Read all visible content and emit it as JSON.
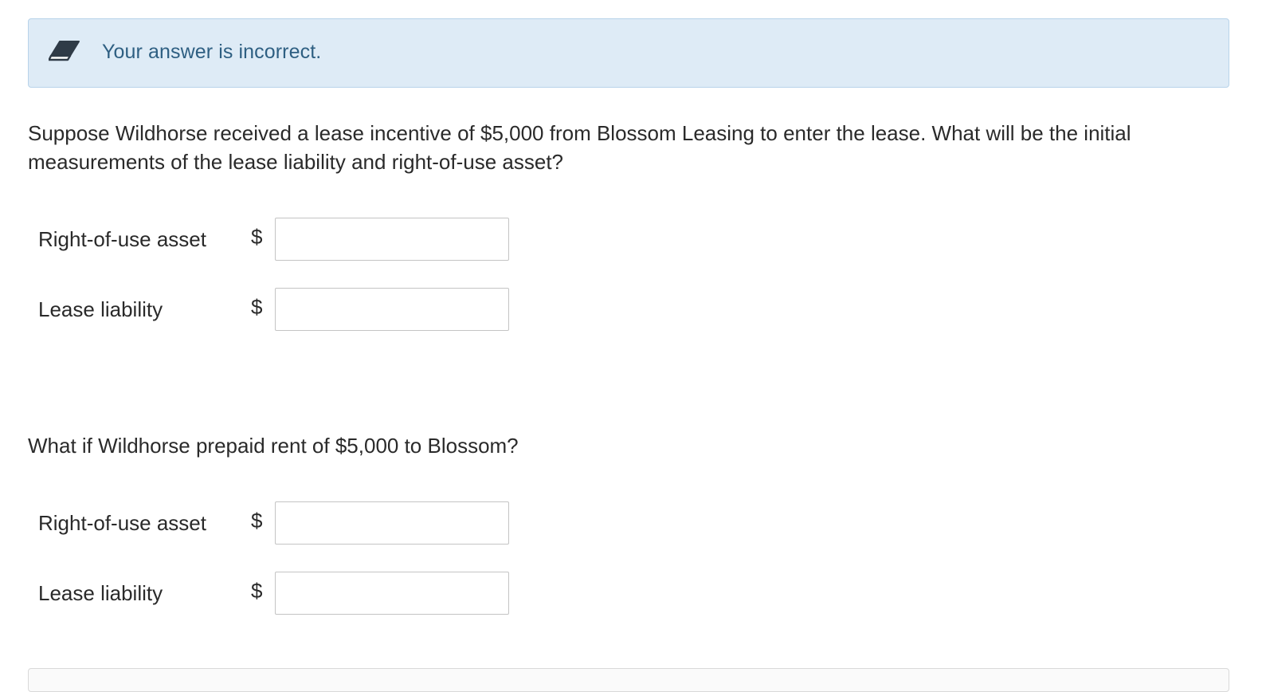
{
  "feedback": {
    "message": "Your answer is incorrect.",
    "icon": "eraser-icon",
    "background_color": "#deebf6",
    "text_color": "#2e5f82"
  },
  "part1": {
    "question": "Suppose Wildhorse received a lease incentive of $5,000 from Blossom Leasing to enter the lease. What will be the initial measurements of the lease liability and right-of-use asset?",
    "fields": [
      {
        "label": "Right-of-use asset",
        "currency": "$",
        "value": ""
      },
      {
        "label": "Lease liability",
        "currency": "$",
        "value": ""
      }
    ]
  },
  "part2": {
    "question": "What if Wildhorse prepaid rent of $5,000 to Blossom?",
    "fields": [
      {
        "label": "Right-of-use asset",
        "currency": "$",
        "value": ""
      },
      {
        "label": "Lease liability",
        "currency": "$",
        "value": ""
      }
    ]
  }
}
